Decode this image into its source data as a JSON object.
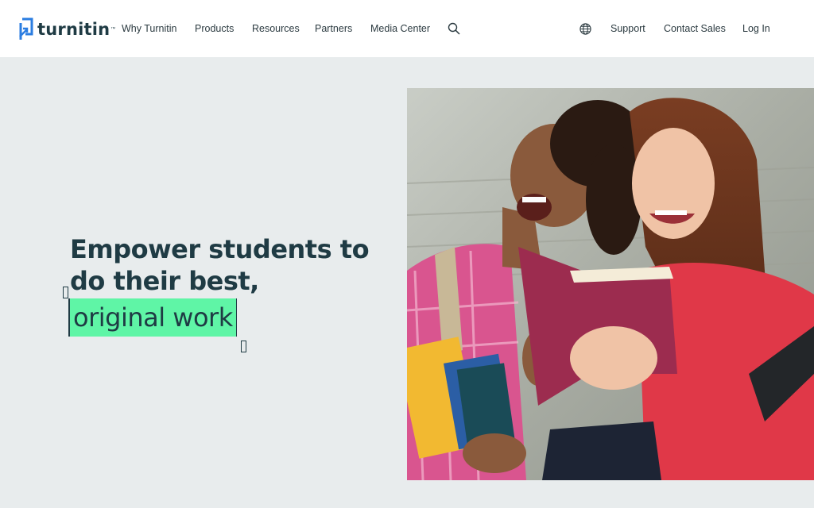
{
  "brand": {
    "name": "turnitin",
    "trademark": "™",
    "logo_icon": "turnitin-logo-icon",
    "color": "#2b7de1"
  },
  "nav": {
    "items": [
      {
        "label": "Why Turnitin"
      },
      {
        "label": "Products"
      },
      {
        "label": "Resources"
      },
      {
        "label": "Partners"
      },
      {
        "label": "Media Center"
      }
    ],
    "search_icon": "search-icon",
    "globe_icon": "globe-icon",
    "right_items": [
      {
        "label": "Support"
      },
      {
        "label": "Contact Sales"
      },
      {
        "label": "Log In"
      }
    ]
  },
  "hero": {
    "line1": "Empower students to",
    "line2": "do their best,",
    "highlight": "original work",
    "highlight_color": "#5ff5a6",
    "text_color": "#1f3b44",
    "background": "#e8eced"
  },
  "photo": {
    "subject": "two-students-laughing-reading-book"
  }
}
